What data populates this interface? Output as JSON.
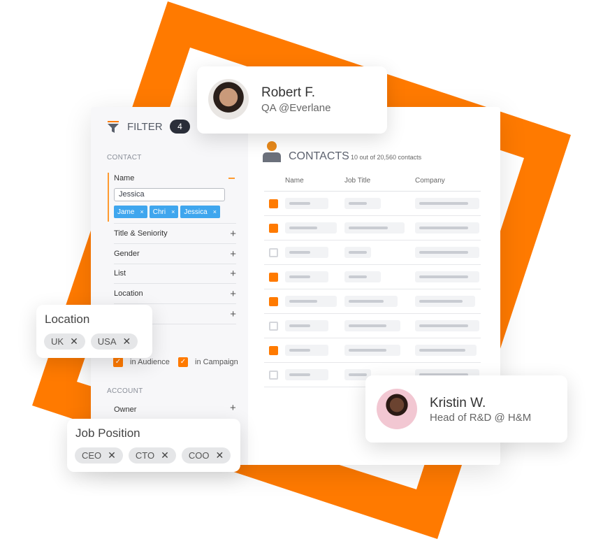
{
  "colors": {
    "accent": "#ff7a00",
    "tag": "#3fa6ee",
    "badge": "#2b2f3a"
  },
  "filter": {
    "title": "FILTER",
    "count": "4",
    "icon": "funnel-icon",
    "contact_section": "CONTACT",
    "name_label": "Name",
    "name_value": "Jessica",
    "name_tags": [
      "Jame",
      "Chri",
      "Jessica"
    ],
    "rows": [
      "Title & Seniority",
      "Gender",
      "List",
      "Location",
      ""
    ],
    "checks": [
      {
        "label": "in Audience",
        "checked": true
      },
      {
        "label": "in Campaign",
        "checked": true
      }
    ],
    "account_section": "ACCOUNT",
    "owner_label": "Owner"
  },
  "contacts": {
    "title": "CONTACTS",
    "subtitle": "10 out of 20,560 contacts",
    "icon": "person-icon",
    "columns": [
      "Name",
      "Job Title",
      "Company"
    ],
    "rows_checked": [
      true,
      true,
      false,
      true,
      true,
      false,
      true,
      false
    ]
  },
  "profile_robert": {
    "name": "Robert F.",
    "role": "QA @Everlane"
  },
  "profile_kristin": {
    "name": "Kristin W.",
    "role": "Head of R&D @ H&M"
  },
  "location_card": {
    "title": "Location",
    "chips": [
      "UK",
      "USA"
    ]
  },
  "job_card": {
    "title": "Job Position",
    "chips": [
      "CEO",
      "CTO",
      "COO"
    ]
  }
}
